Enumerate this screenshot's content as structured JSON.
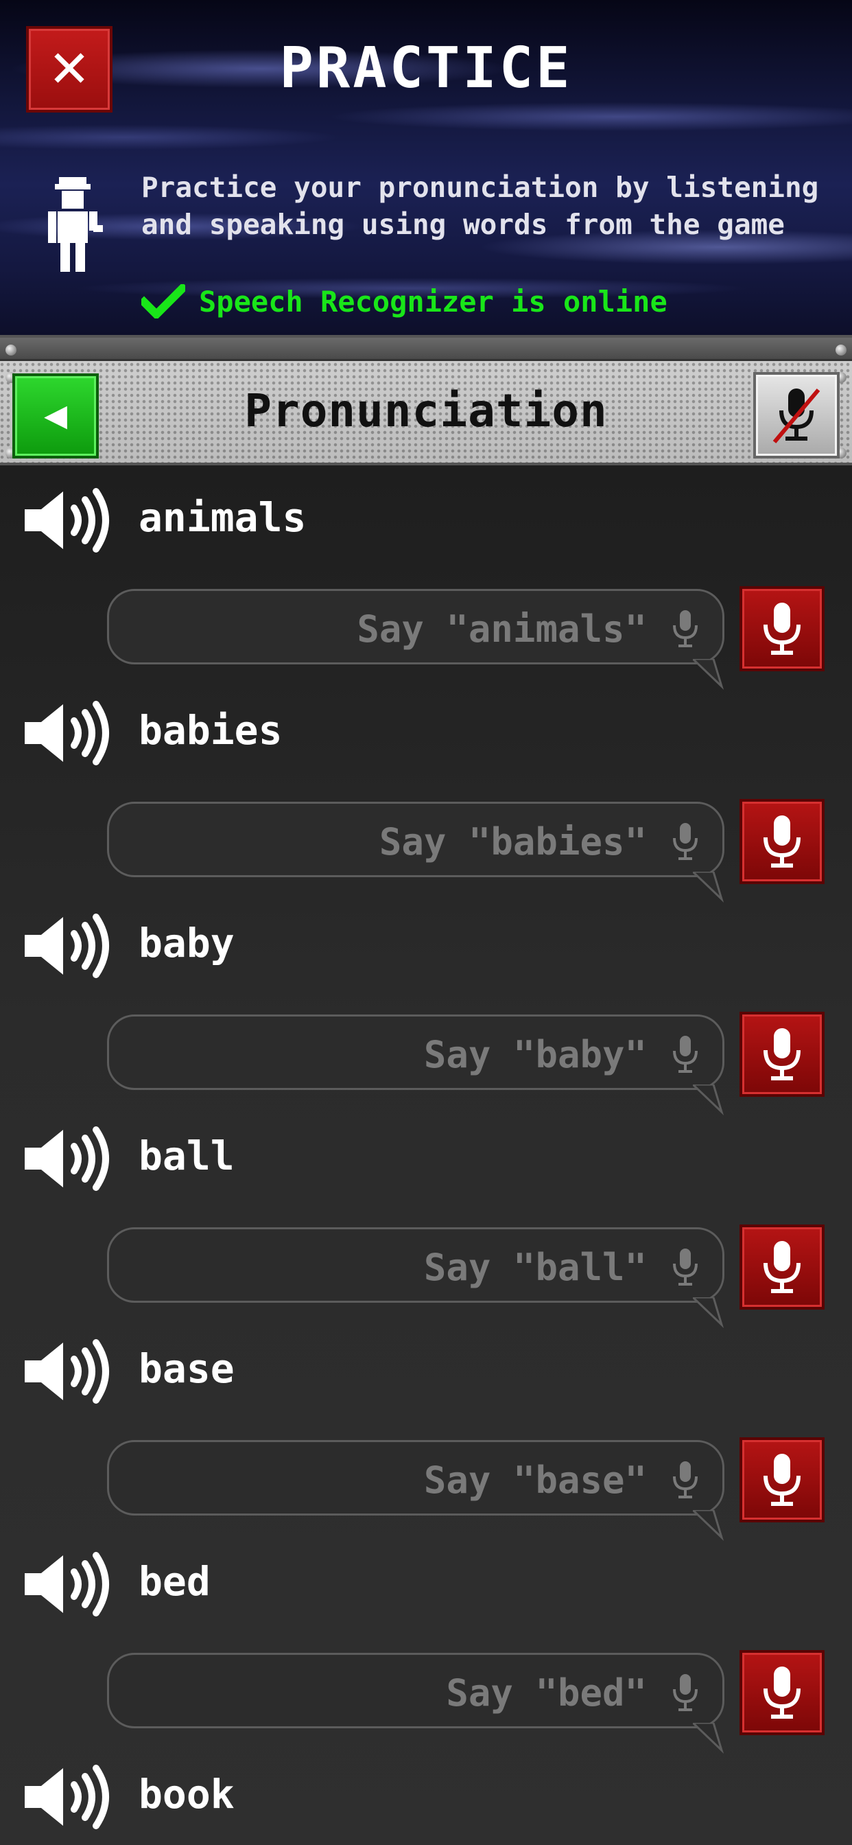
{
  "header": {
    "title": "PRACTICE",
    "intro_line1": "Practice your pronunciation by listening",
    "intro_line2": "and speaking using words from the game",
    "status": "Speech Recognizer is online",
    "status_color": "#19e619"
  },
  "toolbar": {
    "title": "Pronunciation",
    "back_icon": "back-arrow-icon",
    "mic_off_icon": "microphone-muted-icon"
  },
  "words": [
    {
      "word": "animals",
      "prompt": "Say \"animals\""
    },
    {
      "word": "babies",
      "prompt": "Say \"babies\""
    },
    {
      "word": "baby",
      "prompt": "Say \"baby\""
    },
    {
      "word": "ball",
      "prompt": "Say \"ball\""
    },
    {
      "word": "base",
      "prompt": "Say \"base\""
    },
    {
      "word": "bed",
      "prompt": "Say \"bed\""
    },
    {
      "word": "book",
      "prompt": ""
    }
  ],
  "colors": {
    "close_button": "#b51414",
    "back_button": "#1cc21c",
    "record_button": "#9a0d0d"
  }
}
